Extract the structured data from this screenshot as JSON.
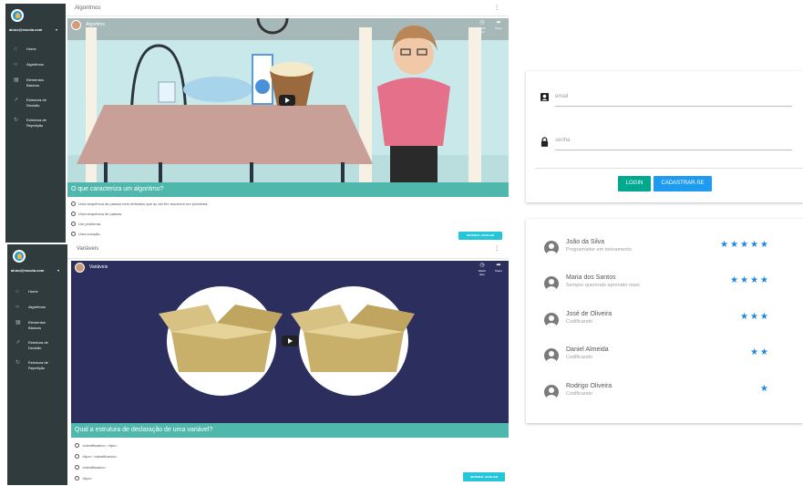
{
  "colors": {
    "sidebar": "#2f3b3c",
    "teal": "#4fb7ac",
    "cyan_button": "#26c6da",
    "login_button": "#00a88f",
    "signup_button": "#1e9bf0",
    "star": "#1e88e5"
  },
  "screen1": {
    "sidebar": {
      "email": "aluno@escola.com",
      "items": [
        {
          "icon": "home-icon",
          "label": "Home"
        },
        {
          "icon": "code-icon",
          "label": "Algoritmos"
        },
        {
          "icon": "grid-icon",
          "label": "Elementos Básicos"
        },
        {
          "icon": "branch-icon",
          "label": "Estrutura de Decisão"
        },
        {
          "icon": "loop-icon",
          "label": "Estrutura de Repetição"
        }
      ]
    },
    "topbar_title": "Algoritmos",
    "video": {
      "title": "Algoritmo",
      "watch_later": "Watch later",
      "share": "Share"
    },
    "question": "O que caracteriza um algoritmo?",
    "options": [
      "Uma sequência de passos bem definidos que ao ser fim resolvem um problema.",
      "Uma sequência de passos.",
      "Um problema.",
      "Uma solução."
    ],
    "material_button": "MATERIAL AUXILIAR"
  },
  "screen2": {
    "sidebar": {
      "email": "aluno@escola.com",
      "items": [
        {
          "icon": "home-icon",
          "label": "Home"
        },
        {
          "icon": "code-icon",
          "label": "Algoritmos"
        },
        {
          "icon": "grid-icon",
          "label": "Elementos Básicos"
        },
        {
          "icon": "branch-icon",
          "label": "Estrutura de Decisão"
        },
        {
          "icon": "loop-icon",
          "label": "Estrutura de Repetição"
        }
      ]
    },
    "topbar_title": "Variáveis",
    "video": {
      "title": "Variáveis",
      "watch_later": "Watch later",
      "share": "Share"
    },
    "question": "Qual a estrutura de declaração de uma variável?",
    "options": [
      "<identificador> <tipo>",
      "<tipo> <identificador>",
      "<identificador>",
      "<tipo>"
    ],
    "material_button": "MATERIAL AUXILIAR"
  },
  "login": {
    "email_placeholder": "email",
    "password_placeholder": "senha",
    "login_button": "LOGIN",
    "signup_button": "CADASTRAR-SE"
  },
  "ranking": [
    {
      "name": "João da Silva",
      "subtitle": "Programador em treinamento",
      "stars": 5
    },
    {
      "name": "Maria dos Santos",
      "subtitle": "Sempre querendo aprender mais",
      "stars": 4
    },
    {
      "name": "José de Oliveira",
      "subtitle": "Codificando",
      "stars": 3
    },
    {
      "name": "Daniel Almeida",
      "subtitle": "Codificando",
      "stars": 2
    },
    {
      "name": "Rodrigo Oliveira",
      "subtitle": "Codificando",
      "stars": 1
    }
  ]
}
